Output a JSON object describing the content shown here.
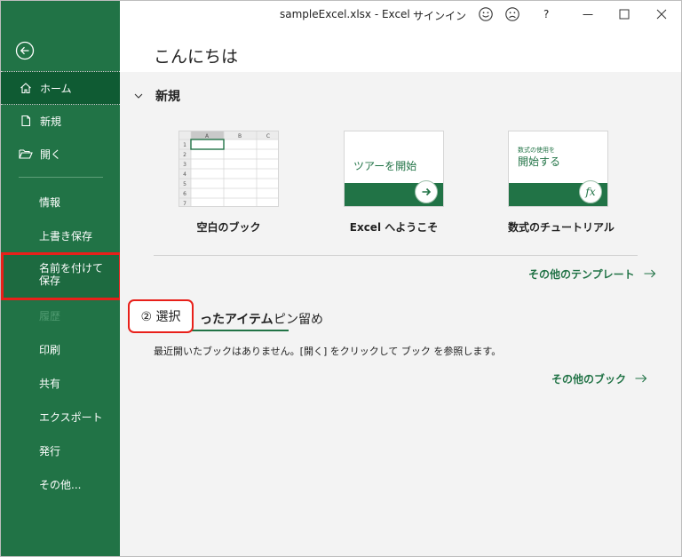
{
  "window": {
    "file_title": "sampleExcel.xlsx  -  Excel",
    "signin": "サインイン",
    "help": "?"
  },
  "header": {
    "greeting": "こんにちは"
  },
  "sidebar": {
    "items": [
      {
        "label": "ホーム",
        "icon": "home-icon"
      },
      {
        "label": "新規",
        "icon": "new-file-icon"
      },
      {
        "label": "開く",
        "icon": "open-folder-icon"
      },
      {
        "label": "情報"
      },
      {
        "label": "上書き保存"
      },
      {
        "label": "名前を付けて保存"
      },
      {
        "label": "履歴"
      },
      {
        "label": "印刷"
      },
      {
        "label": "共有"
      },
      {
        "label": "エクスポート"
      },
      {
        "label": "発行"
      },
      {
        "label": "その他..."
      }
    ]
  },
  "new_section": {
    "title": "新規",
    "templates": [
      {
        "label": "空白のブック",
        "grid_cols": [
          "A",
          "B",
          "C"
        ],
        "grid_rows": [
          "1",
          "2",
          "3",
          "4",
          "5",
          "6",
          "7"
        ]
      },
      {
        "label": "Excel へようこそ",
        "thumb_text": "ツアーを開始"
      },
      {
        "label": "数式のチュートリアル",
        "thumb_small": "数式の使用を",
        "thumb_big": "開始する",
        "thumb_icon": "fx"
      }
    ],
    "more_templates": "その他のテンプレート"
  },
  "recent": {
    "tabs": [
      "ったアイテム",
      "ピン留め"
    ],
    "message": "最近開いたブックはありません。[開く] をクリックして ブック を参照します。",
    "more_books": "その他のブック"
  },
  "callout": {
    "text": "② 選択"
  },
  "colors": {
    "excel_green": "#217346",
    "highlight_red": "#e8201a"
  }
}
